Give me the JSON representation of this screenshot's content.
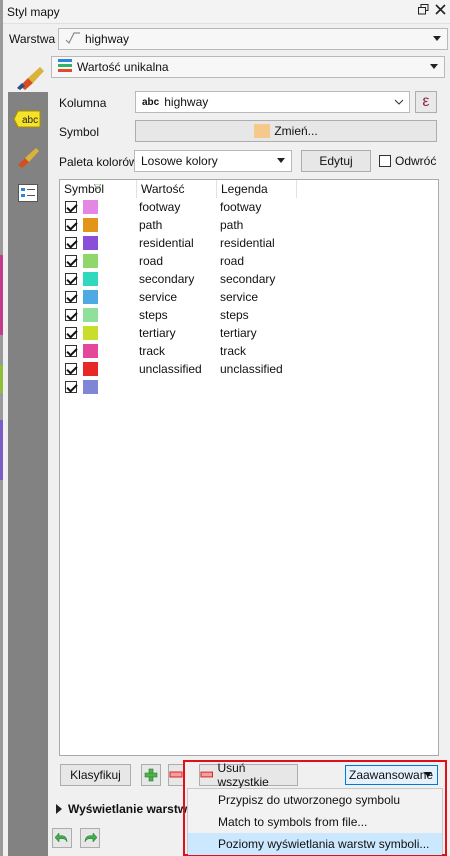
{
  "window": {
    "title": "Styl mapy"
  },
  "layer": {
    "label": "Warstwa",
    "value": "highway"
  },
  "renderer": {
    "value": "Wartość unikalna"
  },
  "column": {
    "label": "Kolumna",
    "type_tag": "abc",
    "value": "highway",
    "expr_glyph": "ε"
  },
  "symbol": {
    "label": "Symbol",
    "change_label": "Zmień..."
  },
  "palette": {
    "label": "Paleta kolorów",
    "value": "Losowe kolory",
    "edit_label": "Edytuj",
    "invert_label": "Odwróć"
  },
  "table": {
    "headers": [
      "Symbol",
      "Wartość",
      "Legenda"
    ],
    "rows": [
      {
        "value": "footway",
        "legend": "footway",
        "color": "#e487e4"
      },
      {
        "value": "path",
        "legend": "path",
        "color": "#e3941a"
      },
      {
        "value": "residential",
        "legend": "residential",
        "color": "#8a4fd9"
      },
      {
        "value": "road",
        "legend": "road",
        "color": "#8fd66b"
      },
      {
        "value": "secondary",
        "legend": "secondary",
        "color": "#2ed9bd"
      },
      {
        "value": "service",
        "legend": "service",
        "color": "#4fa9e3"
      },
      {
        "value": "steps",
        "legend": "steps",
        "color": "#8fe09b"
      },
      {
        "value": "tertiary",
        "legend": "tertiary",
        "color": "#c9dd2c"
      },
      {
        "value": "track",
        "legend": "track",
        "color": "#e3489b"
      },
      {
        "value": "unclassified",
        "legend": "unclassified",
        "color": "#e82727"
      },
      {
        "value": "",
        "legend": "",
        "color": "#7f86d8"
      }
    ]
  },
  "actions": {
    "classify_label": "Klasyfikuj",
    "remove_all_label": "Usuń wszystkie",
    "advanced_label": "Zaawansowane"
  },
  "layer_rendering": {
    "label": "Wyświetlanie warstw"
  },
  "advanced_menu": {
    "items": [
      "Przypisz do utworzonego symbolu",
      "Match to symbols from file...",
      "Poziomy wyświetlania warstw symboli..."
    ]
  },
  "icons": {
    "close": "close-icon",
    "float": "float-icon",
    "brush": "paint-brush-icon",
    "undo": "undo-icon",
    "redo": "redo-icon",
    "add": "plus-icon",
    "remove": "minus-icon"
  }
}
